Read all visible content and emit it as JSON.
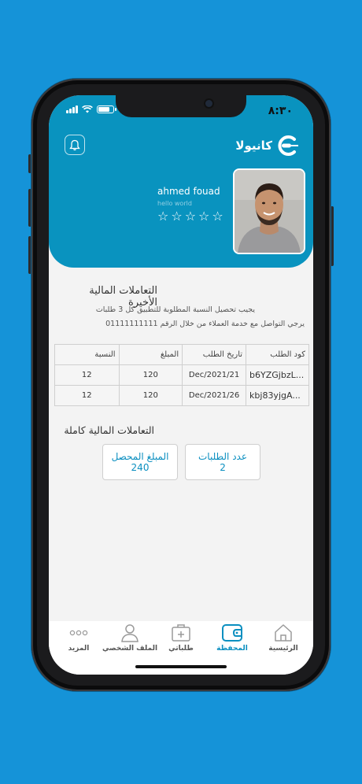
{
  "status": {
    "time": "٨:٣٠"
  },
  "brand": {
    "logo_text": "كانيولا"
  },
  "user": {
    "name": "ahmed fouad",
    "tagline": "hello world",
    "rating": 0,
    "rating_max": 5
  },
  "recent": {
    "title": "التعاملات المالية الأخيرة",
    "note_line1": "يجيب تحصيل النسبة المطلوبة للتطبيق كل 3 طلبات",
    "note_line2": "يرجي التواصل مع خدمة العملاء من خلال الرقم 01111111111",
    "columns": [
      "كود الطلب",
      "تاريخ الطلب",
      "المبلغ",
      "النسبة"
    ],
    "rows": [
      {
        "code": "b6YZGjbzL...",
        "date": "21/Dec/2021",
        "amount": "120",
        "ratio": "12"
      },
      {
        "code": "kbj83yjgA...",
        "date": "26/Dec/2021",
        "amount": "120",
        "ratio": "12"
      }
    ]
  },
  "full": {
    "title": "التعاملات المالية كاملة",
    "orders_count_label": "عدد الطلبات",
    "orders_count_value": "2",
    "collected_label": "المبلغ المحصل",
    "collected_value": "240"
  },
  "tabs": [
    {
      "label": "المزيد",
      "icon": "more-icon"
    },
    {
      "label": "الملف الشخصي",
      "icon": "profile-icon"
    },
    {
      "label": "طلباتي",
      "icon": "orders-icon"
    },
    {
      "label": "المحفظة",
      "icon": "wallet-icon",
      "active": true
    },
    {
      "label": "الرئيسية",
      "icon": "home-icon"
    }
  ],
  "colors": {
    "background": "#1593d8",
    "header": "#0993bf",
    "accent": "#0b8fc0"
  }
}
